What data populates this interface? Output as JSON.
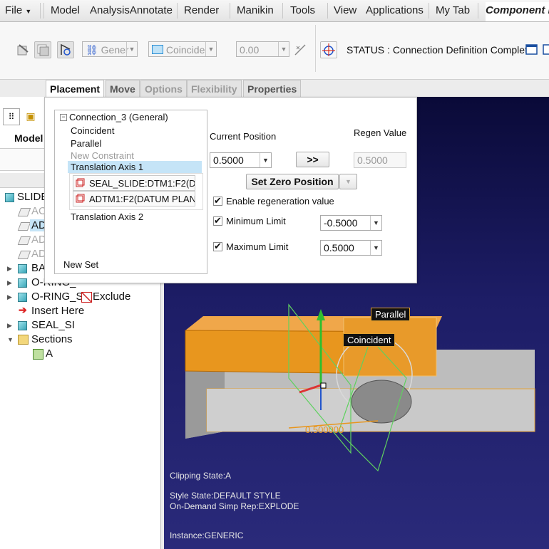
{
  "menu": {
    "file": "File",
    "items": [
      "Model",
      "AnalysisAnnotate",
      "Render",
      "Manikin",
      "Tools",
      "View",
      "Applications",
      "My Tab"
    ],
    "component_tab": "Component P"
  },
  "ribbon": {
    "connection_type": "Gener",
    "constraint_type": "Coincide",
    "offset_value": "0.00",
    "status": "STATUS : Connection Definition Complete."
  },
  "tabs": [
    "Placement",
    "Move",
    "Options",
    "Flexibility",
    "Properties"
  ],
  "placement": {
    "tree": {
      "connection": "Connection_3 (General)",
      "items": [
        "Coincident",
        "Parallel"
      ],
      "new_constraint": "New Constraint",
      "selected_axis": "Translation Axis 1",
      "refs": [
        "SEAL_SLIDE:DTM1:F2(D",
        "ADTM1:F2(DATUM PLAN"
      ],
      "axis2": "Translation Axis 2",
      "new_set": "New Set"
    },
    "current_position_label": "Current Position",
    "regen_value_label": "Regen Value",
    "current_position": "0.5000",
    "arrow_button": ">>",
    "regen_value": "0.5000",
    "set_zero": "Set Zero Position",
    "enable_regen": "Enable regeneration value",
    "min_limit_label": "Minimum Limit",
    "min_limit": "-0.5000",
    "max_limit_label": "Maximum Limit",
    "max_limit": "0.5000"
  },
  "left_panel": {
    "header": "Model",
    "items": [
      {
        "text": "SLIDE",
        "icon": "assembly-icon"
      },
      {
        "text": "AC",
        "icon": "datum-plane-icon"
      },
      {
        "text": "AD",
        "icon": "datum-plane-icon"
      },
      {
        "text": "AD",
        "icon": "datum-plane-icon"
      },
      {
        "text": "AD",
        "icon": "datum-plane-icon"
      },
      {
        "text": "BA",
        "icon": "part-icon"
      },
      {
        "text": "O-RING_",
        "icon": "part-icon"
      },
      {
        "text": "O-RING_S",
        "icon": "part-icon"
      },
      {
        "text": "Exclude",
        "icon": "exclude-icon"
      },
      {
        "text": "Insert Here",
        "icon": "insert-arrow-icon"
      },
      {
        "text": "SEAL_SI",
        "icon": "part-icon"
      },
      {
        "text": "Sections",
        "icon": "folder-icon"
      },
      {
        "text": "A",
        "icon": "section-icon"
      }
    ]
  },
  "viewport": {
    "callouts": [
      "Parallel",
      "Coincident"
    ],
    "dimension": "0.500000",
    "info": [
      "Clipping State:A",
      "Style State:DEFAULT STYLE",
      "On-Demand Simp Rep:EXPLODE",
      "Instance:GENERIC"
    ]
  },
  "colors": {
    "orange_part": "#e8961e",
    "grey_part": "#c8c8c8",
    "viewport_bg": "#1a1a5c",
    "highlight": "#c5e4f7"
  }
}
